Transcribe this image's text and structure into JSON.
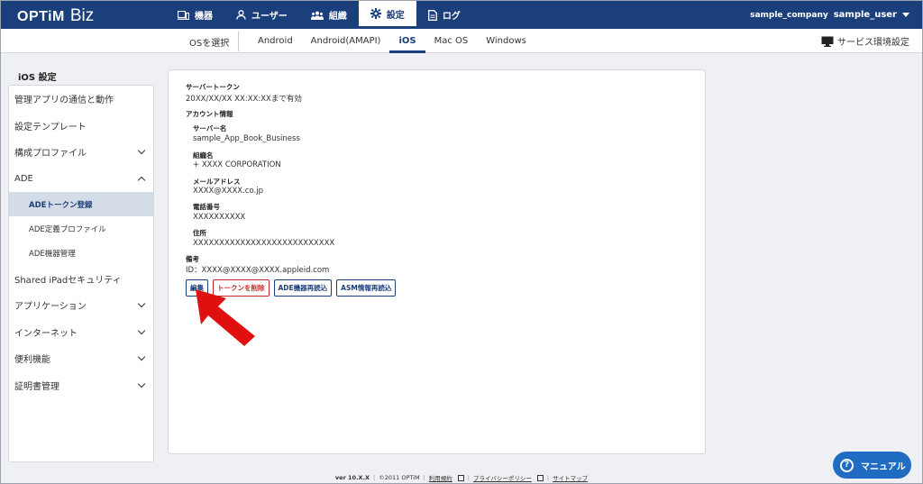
{
  "header": {
    "logo_optim": "OPTiM",
    "logo_biz": "Biz",
    "nav": [
      {
        "label": "機器",
        "icon": "device-icon"
      },
      {
        "label": "ユーザー",
        "icon": "user-icon"
      },
      {
        "label": "組織",
        "icon": "group-icon"
      },
      {
        "label": "設定",
        "icon": "gear-icon"
      },
      {
        "label": "ログ",
        "icon": "document-icon"
      }
    ],
    "active_nav": "設定",
    "company": "sample_company",
    "user": "sample_user"
  },
  "subbar": {
    "os_select_label": "OSを選択",
    "tabs": [
      "Android",
      "Android(AMAPI)",
      "iOS",
      "Mac OS",
      "Windows"
    ],
    "active_tab": "iOS",
    "env_label": "サービス環境設定"
  },
  "sidebar": {
    "title": "iOS 設定",
    "items": [
      {
        "label": "管理アプリの通信と動作"
      },
      {
        "label": "設定テンプレート"
      },
      {
        "label": "構成プロファイル"
      },
      {
        "label": "ADE"
      },
      {
        "label": "ADEトークン登録"
      },
      {
        "label": "ADE定義プロファイル"
      },
      {
        "label": "ADE機器管理"
      },
      {
        "label": "Shared iPadセキュリティ"
      },
      {
        "label": "アプリケーション"
      },
      {
        "label": "インターネット"
      },
      {
        "label": "便利機能"
      },
      {
        "label": "証明書管理"
      }
    ]
  },
  "main": {
    "server_token_label": "サーバートークン",
    "server_token_value": "20XX/XX/XX XX:XX:XXまで有効",
    "account_info_label": "アカウント情報",
    "server_name_label": "サーバー名",
    "server_name_value": "sample_App_Book_Business",
    "org_label": "組織名",
    "org_value": "+ XXXX CORPORATION",
    "email_label": "メールアドレス",
    "email_value": "XXXX@XXXX.co.jp",
    "phone_label": "電話番号",
    "phone_value": "XXXXXXXXXX",
    "address_label": "住所",
    "address_value": "XXXXXXXXXXXXXXXXXXXXXXXXXXX",
    "note_label": "備考",
    "note_value": "ID：XXXX@XXXX@XXXX.appleid.com",
    "buttons": {
      "edit": "編集",
      "delete": "トークンを削除",
      "ade_reload": "ADE機器再読込",
      "asm_reload": "ASM情報再読込"
    }
  },
  "footer": {
    "version": "ver 10.X.X",
    "copyright": "©2011 OPTiM",
    "terms": "利用規約",
    "privacy": "プライバシーポリシー",
    "sitemap": "サイトマップ"
  },
  "manual_button": "マニュアル",
  "colors": {
    "brand": "#1b3f7a",
    "danger": "#c62828",
    "arrow": "#e01010",
    "manual": "#1f6cc2"
  }
}
